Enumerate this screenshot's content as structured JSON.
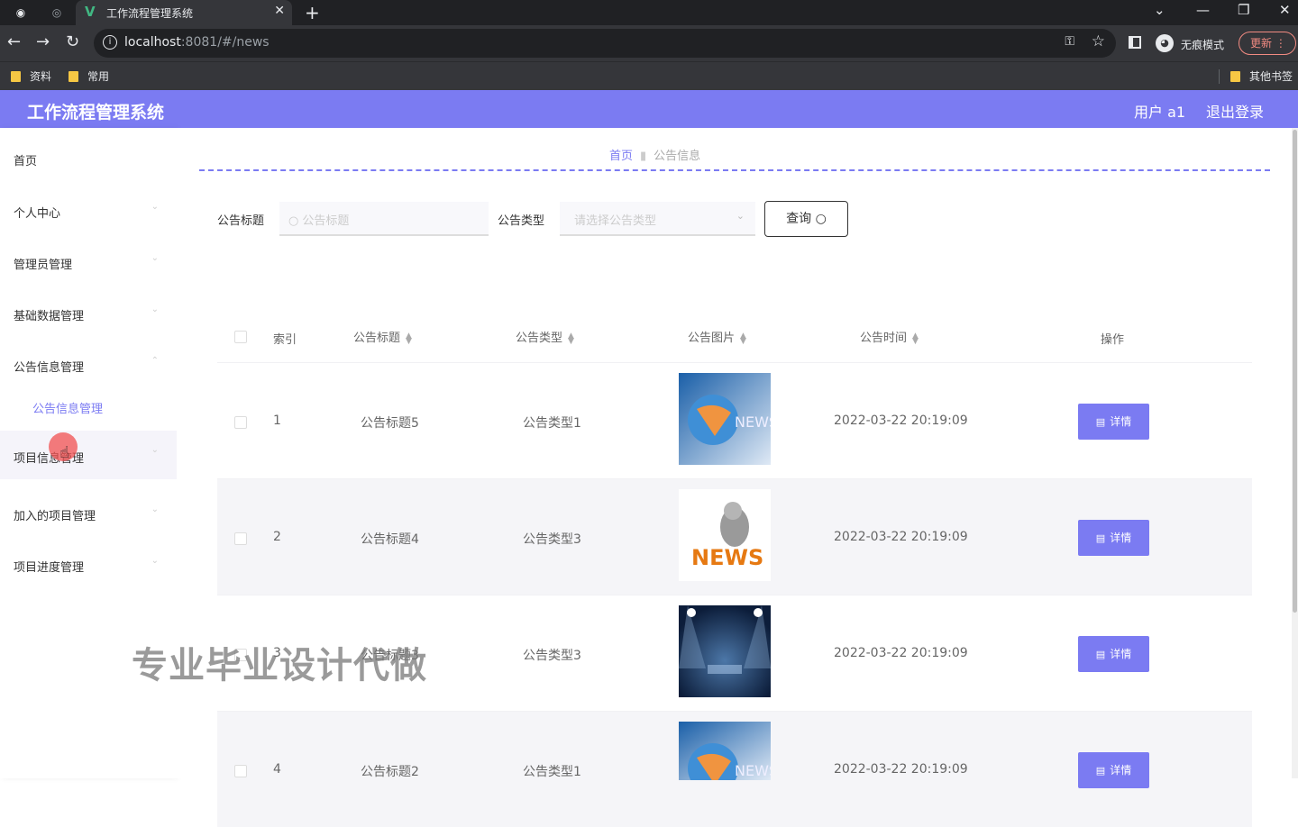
{
  "browser": {
    "tab_title": "工作流程管理系统",
    "url_host": "localhost",
    "url_rest": ":8081/#/news",
    "incognito_label": "无痕模式",
    "update_label": "更新",
    "bookmarks": [
      "资料",
      "常用"
    ],
    "other_bookmarks": "其他书签"
  },
  "header": {
    "brand": "工作流程管理系统",
    "user": "用户 a1",
    "logout": "退出登录"
  },
  "sidebar": {
    "items": [
      {
        "label": "首页"
      },
      {
        "label": "个人中心"
      },
      {
        "label": "管理员管理"
      },
      {
        "label": "基础数据管理"
      },
      {
        "label": "公告信息管理"
      },
      {
        "label": "项目信息管理"
      },
      {
        "label": "加入的项目管理"
      },
      {
        "label": "项目进度管理"
      }
    ],
    "sub_item": "公告信息管理"
  },
  "breadcrumb": {
    "home": "首页",
    "current": "公告信息"
  },
  "search": {
    "title_label": "公告标题",
    "title_placeholder": "公告标题",
    "type_label": "公告类型",
    "type_placeholder": "请选择公告类型",
    "query_button": "查询"
  },
  "table": {
    "headers": [
      "索引",
      "公告标题",
      "公告类型",
      "公告图片",
      "公告时间",
      "操作"
    ],
    "detail_label": "详情",
    "rows": [
      {
        "index": "1",
        "title": "公告标题5",
        "type": "公告类型1",
        "time": "2022-03-22 20:19:09",
        "image": "news-globe-image"
      },
      {
        "index": "2",
        "title": "公告标题4",
        "type": "公告类型3",
        "time": "2022-03-22 20:19:09",
        "image": "news-reader-image"
      },
      {
        "index": "3",
        "title": "公告标题3",
        "type": "公告类型3",
        "time": "2022-03-22 20:19:09",
        "image": "news-stage-image"
      },
      {
        "index": "4",
        "title": "公告标题2",
        "type": "公告类型1",
        "time": "2022-03-22 20:19:09",
        "image": "news-globe-image"
      }
    ]
  },
  "watermark": "专业毕业设计代做",
  "colors": {
    "accent": "#7b7bf2"
  }
}
